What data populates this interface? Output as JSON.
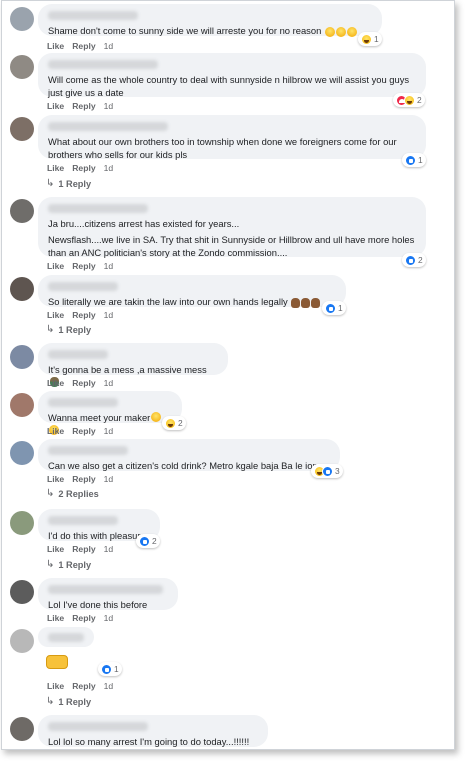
{
  "labels": {
    "like": "Like",
    "reply": "Reply"
  },
  "comments": [
    {
      "text": "Shame don't come to sunny side we will arreste you for no reason",
      "time": "1d",
      "reaction_count": "1"
    },
    {
      "text": "Will come as the whole country to deal with sunnyside n hilbrow we will assist you guys just give us a date",
      "time": "1d",
      "reaction_count": "2"
    },
    {
      "text": "What about our own brothers too in township when done we foreigners come for our brothers who sells for our kids pls",
      "time": "1d",
      "reaction_count": "1",
      "replies": "1 Reply"
    },
    {
      "text1": "Ja bru....citizens arrest has existed for years...",
      "text2": "Newsflash....we live in SA. Try that shit in Sunnyside or Hillbrow and ull have more holes than an ANC politician's story at the Zondo commission....",
      "time": "1d",
      "reaction_count": "2"
    },
    {
      "text": "So literally we are takin the law into our own hands legally",
      "time": "1d",
      "reaction_count": "1",
      "replies": "1 Reply"
    },
    {
      "text": "It's gonna be a mess ,a massive mess",
      "time": "1d"
    },
    {
      "text": "Wanna meet your maker",
      "time": "1d",
      "reaction_count": "2"
    },
    {
      "text": "Can we also get a citizen's cold drink? Metro kgale baja Ba le ione",
      "time": "1d",
      "reaction_count": "3",
      "replies": "2 Replies"
    },
    {
      "text": "I'd do this with pleasure.",
      "time": "1d",
      "reaction_count": "2",
      "replies": "1 Reply"
    },
    {
      "text": "Lol I've done this before",
      "time": "1d"
    },
    {
      "time": "1d",
      "reaction_count": "1",
      "replies": "1 Reply"
    },
    {
      "text": "Lol lol so many arrest I'm going to do today...!!!!!!",
      "time": "1d"
    }
  ],
  "icons": {
    "haha": "haha-reaction-icon",
    "like": "like-reaction-icon",
    "love": "love-reaction-icon",
    "reply_arrow": "reply-arrow-icon"
  },
  "colors": {
    "bubble": "#f0f2f5",
    "meta": "#65676b",
    "like_blue": "#1877f2",
    "love_red": "#f0284a"
  }
}
